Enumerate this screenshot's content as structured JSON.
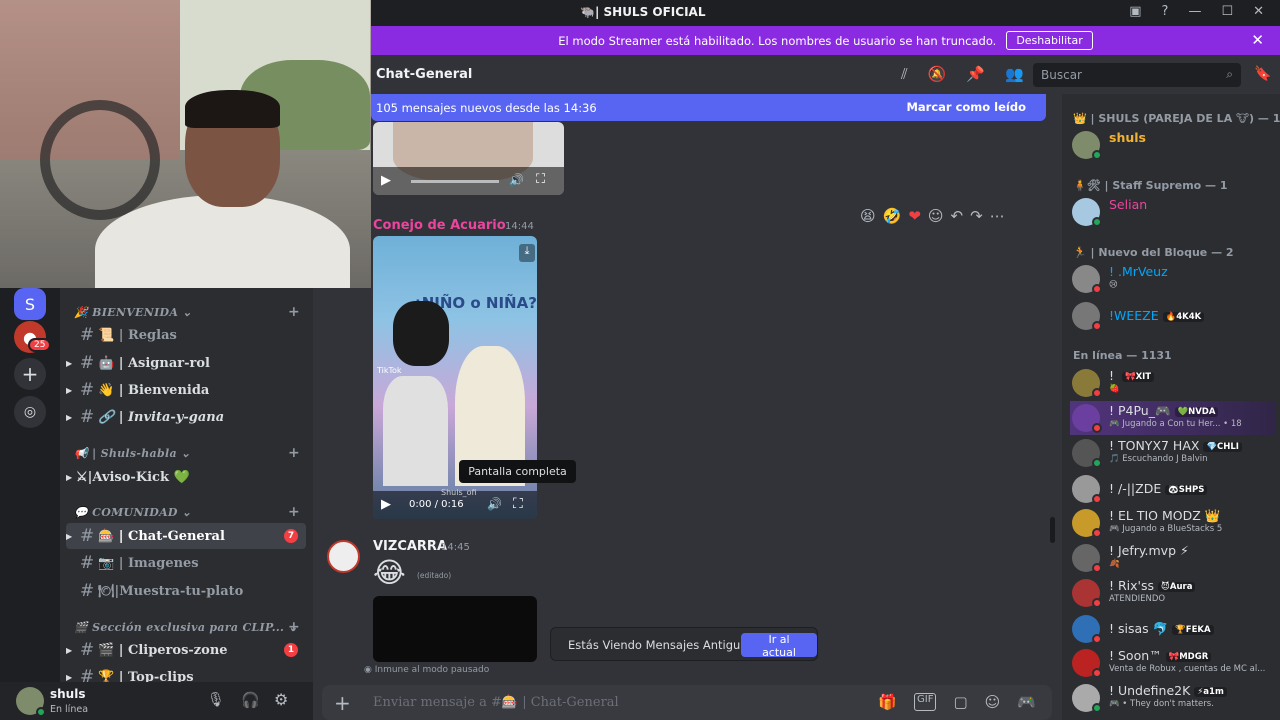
{
  "titlebar": {
    "title": "🐃| SHULS OFICIAL"
  },
  "banner": {
    "text": "El modo Streamer está habilitado. Los nombres de usuario se han truncado.",
    "button": "Deshabilitar"
  },
  "servers": {
    "badge_count": "25"
  },
  "channels": {
    "categories": [
      {
        "label": "BIENVENIDA",
        "icon": "🎉"
      },
      {
        "label": "| Shuls-habla",
        "icon": "📢"
      },
      {
        "label": "COMUNIDAD",
        "icon": "💬"
      },
      {
        "label": "Sección exclusiva para CLIP...",
        "icon": "🎬"
      }
    ],
    "items": [
      {
        "label": "📜 | Reglas"
      },
      {
        "label": "🤖 | Asignar-rol"
      },
      {
        "label": "👋 | Bienvenida"
      },
      {
        "label": "🔗 | Invita-y-gana"
      },
      {
        "label": "⚔|Aviso-Kick 💚"
      },
      {
        "label": "🎰 | Chat-General",
        "badge": "7"
      },
      {
        "label": "📷 | Imagenes"
      },
      {
        "label": "🍽|Muestra-tu-plato"
      },
      {
        "label": "🎬 | Cliperos-zone",
        "badge": "1"
      },
      {
        "label": "🏆 | Top-clips"
      }
    ]
  },
  "user": {
    "name": "shuls",
    "status": "En línea"
  },
  "chat": {
    "channel_name": "Chat-General",
    "search_placeholder": "Buscar",
    "new_messages": "105 mensajes nuevos desde las 14:36",
    "mark_read": "Marcar como leído",
    "msg1": {
      "author": "Conejo de Acuario",
      "time": "14:44",
      "video_time": "0:00 / 0:16",
      "overlay_title": "¿NIÑO o NIÑA?",
      "tiktok": "TikTok",
      "watermark": "Shuls_ofi"
    },
    "tooltip": "Pantalla completa",
    "msg2": {
      "author": "VIZCARRA",
      "time": "14:45",
      "emoji": "😂",
      "edited": "(editado)"
    },
    "immune": "Inmune al modo pausado",
    "old_messages": "Estás Viendo Mensajes Antiguos",
    "jump_button": "Ir al actual",
    "composer_placeholder": "Enviar mensaje a #🎰 | Chat-General"
  },
  "members": {
    "role1": "👑 | SHULS (PAREJA DE LA 🐮) — 1",
    "role2": "🧍🛠 | Staff Supremo — 1",
    "role3": "🏃 | Nuevo del Bloque — 2",
    "online": "En línea — 1131",
    "list": [
      {
        "name": "shuls",
        "color": "#f0b232",
        "dot": "#23a55a",
        "avc": "#7f8c6b"
      },
      {
        "name": "Selian",
        "color": "#eb459e",
        "dot": "#23a55a",
        "avc": "#a6c8e0"
      },
      {
        "name": "! .MrVeuz",
        "color": "#00a8fc",
        "sub": "😢",
        "dot": "#f23f43",
        "avc": "#888"
      },
      {
        "name": "!WEEZE",
        "color": "#00a8fc",
        "tag": "🔥4K4K",
        "dot": "#f23f43",
        "avc": "#777"
      },
      {
        "name": "! ",
        "color": "#dbdee1",
        "tag": "🎀XIT",
        "sub": "🍓",
        "dot": "#f23f43",
        "avc": "#8a7a3a"
      },
      {
        "name": "! P4Pu_🎮",
        "color": "#dbdee1",
        "tag": "💚NVDA",
        "sub": "🎮 Jugando a Con tu Her... • 18",
        "dot": "#f23f43",
        "avc": "#6b3fa0"
      },
      {
        "name": "! TONYX7 HAX",
        "color": "#dbdee1",
        "tag": "💎CHLI",
        "sub": "🎵 Escuchando J Balvin",
        "dot": "#23a55a",
        "avc": "#555"
      },
      {
        "name": "! /-||ZDE",
        "color": "#dbdee1",
        "tag": "🐼SHPS",
        "dot": "#f23f43",
        "avc": "#999"
      },
      {
        "name": "! EL TIO MODZ 👑",
        "color": "#dbdee1",
        "sub": "🎮 Jugando a BlueStacks 5",
        "dot": "#f23f43",
        "avc": "#c79a2a"
      },
      {
        "name": "! Jefry.mvp ⚡",
        "color": "#dbdee1",
        "sub": "🍂",
        "dot": "#f23f43",
        "avc": "#666"
      },
      {
        "name": "! Rix'ss",
        "color": "#dbdee1",
        "tag": "😈Aura",
        "sub": "ATENDIENDO",
        "dot": "#f23f43",
        "avc": "#a33"
      },
      {
        "name": "! sisas 🐬",
        "color": "#dbdee1",
        "tag": "🏆FEKA",
        "dot": "#f23f43",
        "avc": "#2f6fb5"
      },
      {
        "name": "! Soon™",
        "color": "#dbdee1",
        "tag": "🎀MDGR",
        "sub": "Venta de Robux , cuentas de MC al...",
        "dot": "#f23f43",
        "avc": "#b22"
      },
      {
        "name": "! Undefine2K",
        "color": "#dbdee1",
        "tag": "⚡a1m",
        "sub": "🎮 • They don't matters.",
        "dot": "#23a55a",
        "avc": "#aaa"
      }
    ]
  }
}
